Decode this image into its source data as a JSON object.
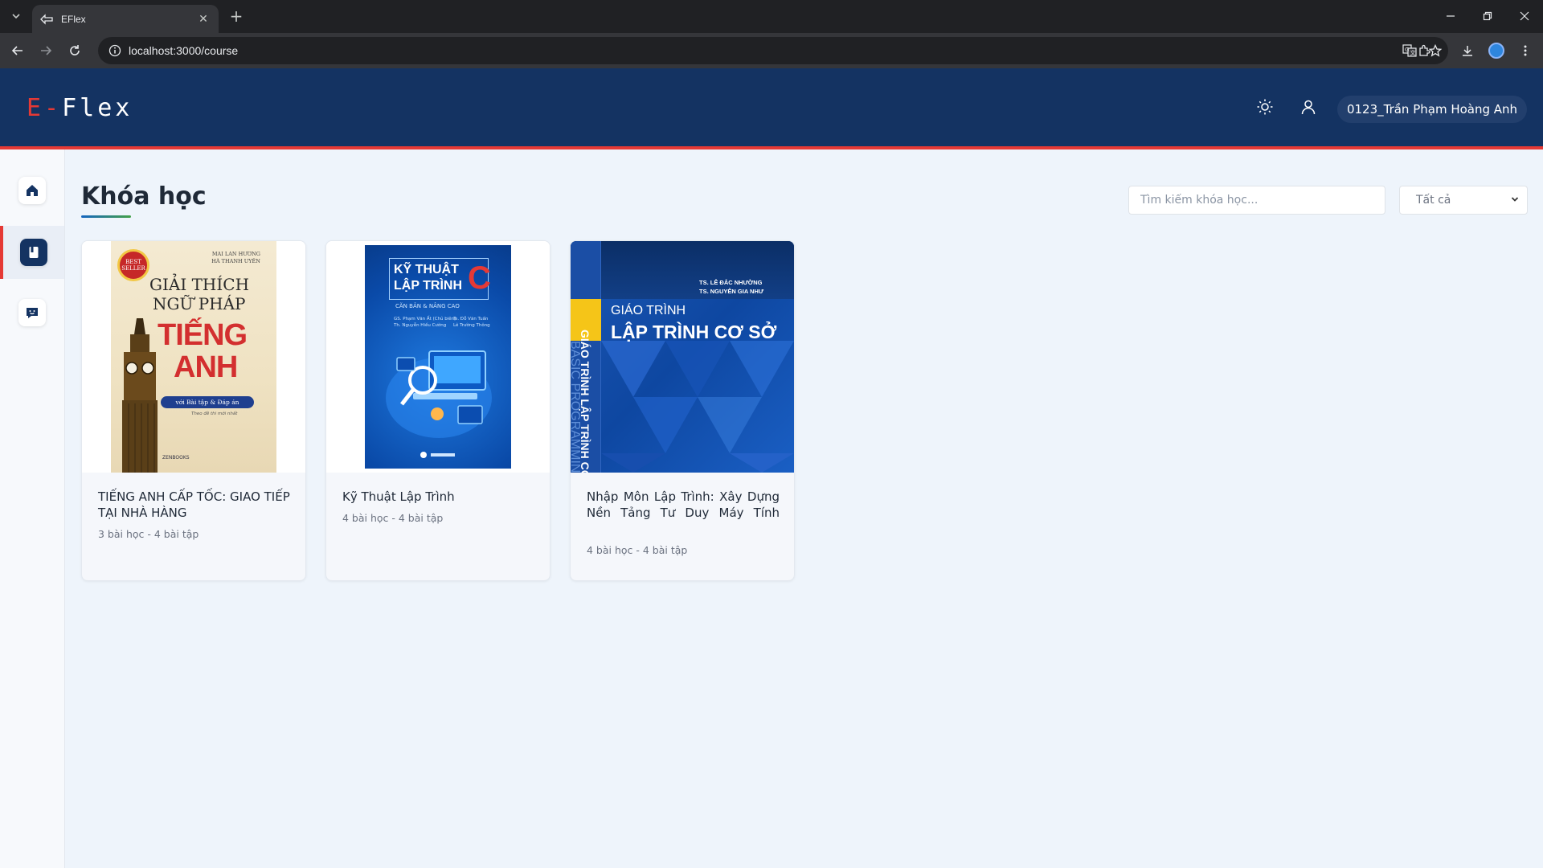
{
  "browser": {
    "tab_title": "EFlex",
    "new_tab_symbol": "+",
    "url": "localhost:3000/course"
  },
  "header": {
    "logo_prefix": "E-",
    "logo_rest": "Flex",
    "user_name": "0123_Trần Phạm Hoàng Anh",
    "theme_icon": "sun-icon",
    "account_icon": "user-icon"
  },
  "sidebar": {
    "items": [
      {
        "name": "home",
        "icon": "home-icon",
        "active": false
      },
      {
        "name": "courses",
        "icon": "book-icon",
        "active": true
      },
      {
        "name": "chat",
        "icon": "chat-icon",
        "active": false
      }
    ]
  },
  "main": {
    "title": "Khóa học",
    "search_placeholder": "Tìm kiếm khóa học...",
    "filter_value": "Tất cả"
  },
  "courses": [
    {
      "title": "TIẾNG ANH CẤP TỐC: GIAO TIẾP TẠI NHÀ HÀNG",
      "meta": "3 bài học - 4 bài tập",
      "cover": {
        "badge": "BEST SELLER",
        "authors": "MAI LAN HƯƠNG\nHÀ THANH UYÊN",
        "line1": "GIẢI THÍCH",
        "line2": "NGỮ PHÁP",
        "line3": "TIẾNG",
        "line4": "ANH",
        "ribbon": "với Bài tập & Đáp án",
        "sub": "Theo đề thi mới nhất",
        "publisher": "ZENBOOKS"
      }
    },
    {
      "title": "Kỹ Thuật Lập Trình",
      "meta": "4 bài học - 4 bài tập",
      "cover": {
        "line1": "KỸ THUẬT",
        "line2": "LẬP TRÌNH",
        "letter": "C",
        "sub": "CĂN BẢN & NÂNG CAO",
        "authors_left": "GS. Phạm Văn Ất (Chủ biên)\nTh. Nguyễn Hiếu Cường",
        "authors_right": "Ts. Đỗ Văn Tuấn\nLê Trường Thông"
      }
    },
    {
      "title": "Nhập Môn Lập Trình: Xây Dựng Nền Tảng Tư Duy Máy Tính",
      "meta": "4 bài học - 4 bài tập",
      "cover": {
        "authors": "TS. LÊ ĐẮC NHƯỜNG\nTS. NGUYỄN GIA NHƯ",
        "line1": "GIÁO TRÌNH",
        "line2": "LẬP TRÌNH CƠ SỞ",
        "spine": "GIÁO TRÌNH LẬP TRÌNH CƠ SỞ",
        "spine2": "BASIC PROGRAMMING"
      }
    }
  ],
  "colors": {
    "header_bg": "#143362",
    "accent_red": "#e53935",
    "page_bg": "#eef4fb"
  }
}
